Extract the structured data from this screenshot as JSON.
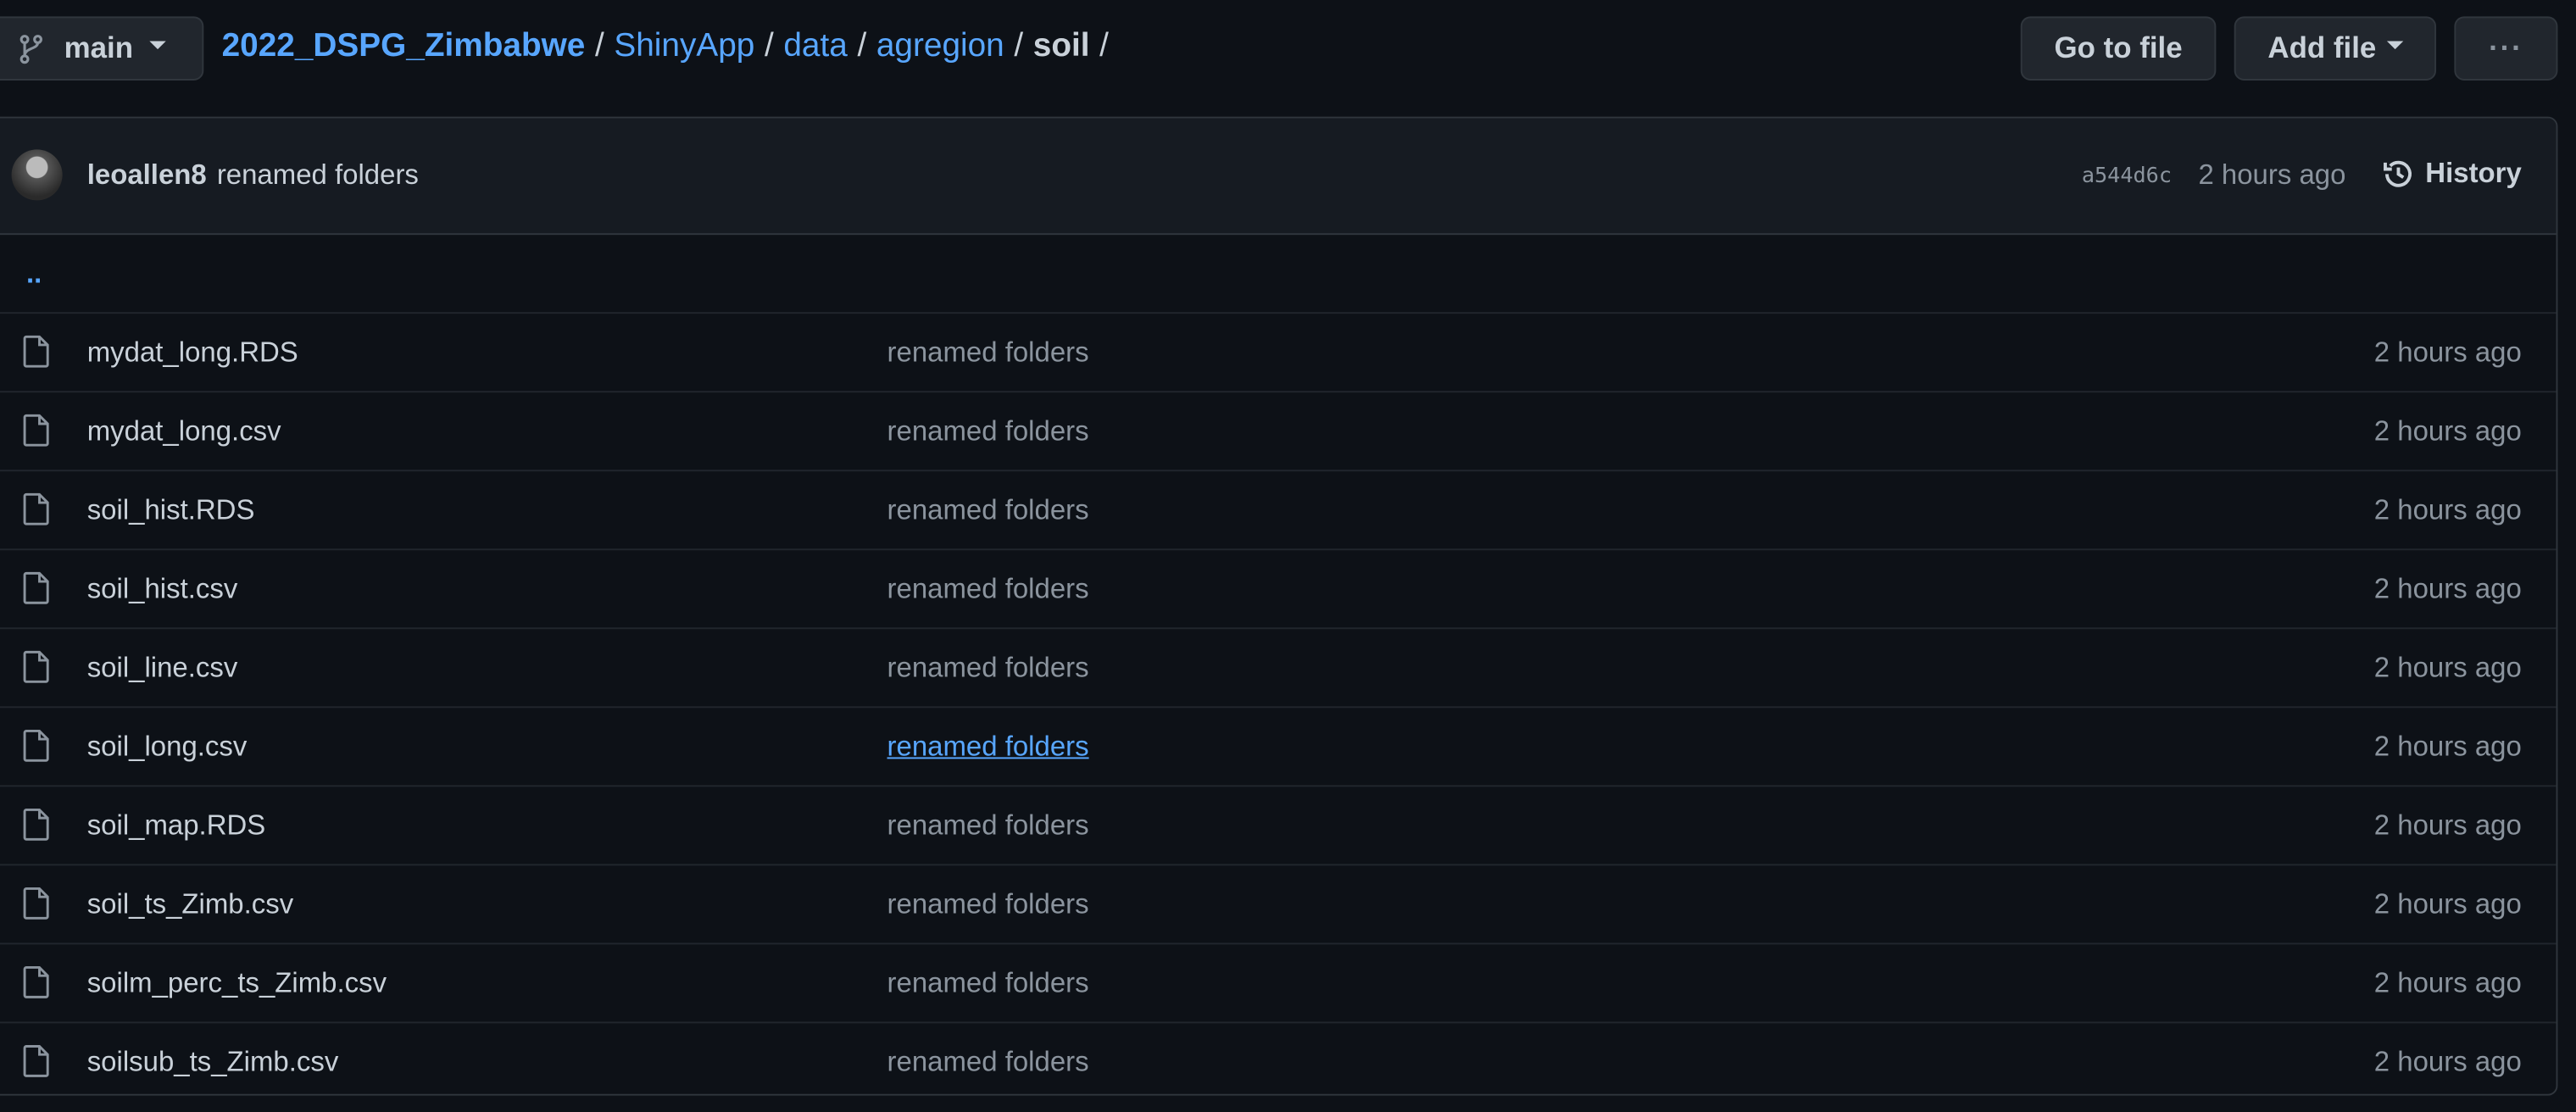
{
  "branch": {
    "name": "main",
    "icon": "git-branch-icon"
  },
  "breadcrumb": {
    "repo": "2022_DSPG_Zimbabwe",
    "parts": [
      "ShinyApp",
      "data",
      "agregion"
    ],
    "current": "soil",
    "sep": "/"
  },
  "toolbar": {
    "goto": "Go to file",
    "add": "Add file",
    "more": "···"
  },
  "commit": {
    "author": "leoallen8",
    "message": "renamed folders",
    "sha": "a544d6c",
    "time": "2 hours ago",
    "history": "History"
  },
  "parent": "..",
  "files": [
    {
      "name": "mydat_long.RDS",
      "message": "renamed folders",
      "time": "2 hours ago"
    },
    {
      "name": "mydat_long.csv",
      "message": "renamed folders",
      "time": "2 hours ago"
    },
    {
      "name": "soil_hist.RDS",
      "message": "renamed folders",
      "time": "2 hours ago"
    },
    {
      "name": "soil_hist.csv",
      "message": "renamed folders",
      "time": "2 hours ago"
    },
    {
      "name": "soil_line.csv",
      "message": "renamed folders",
      "time": "2 hours ago"
    },
    {
      "name": "soil_long.csv",
      "message": "renamed folders",
      "time": "2 hours ago"
    },
    {
      "name": "soil_map.RDS",
      "message": "renamed folders",
      "time": "2 hours ago"
    },
    {
      "name": "soil_ts_Zimb.csv",
      "message": "renamed folders",
      "time": "2 hours ago"
    },
    {
      "name": "soilm_perc_ts_Zimb.csv",
      "message": "renamed folders",
      "time": "2 hours ago"
    },
    {
      "name": "soilsub_ts_Zimb.csv",
      "message": "renamed folders",
      "time": "2 hours ago"
    }
  ]
}
